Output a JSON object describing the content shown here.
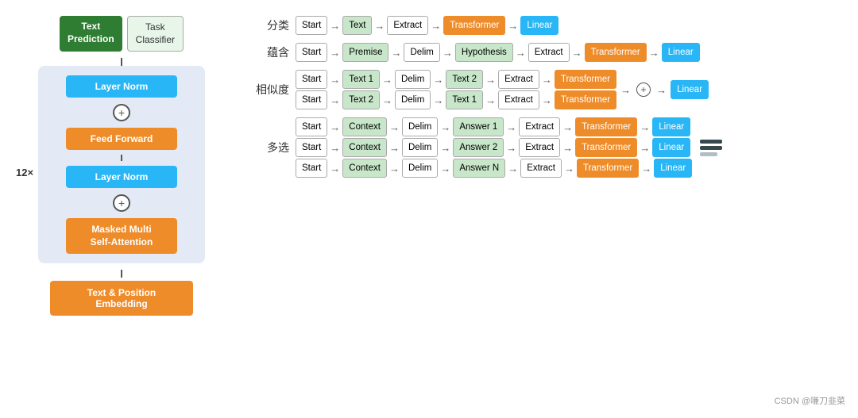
{
  "left": {
    "text_prediction": "Text\nPrediction",
    "task_classifier": "Task\nClassifier",
    "layer_norm_top": "Layer Norm",
    "feed_forward": "Feed Forward",
    "layer_norm_bottom": "Layer Norm",
    "masked_attention": "Masked Multi\nSelf-Attention",
    "embedding": "Text & Position Embedding",
    "label_12x": "12×"
  },
  "tasks": {
    "classification": {
      "label": "分类",
      "sequence": [
        "Start",
        "Text",
        "Extract",
        "Transformer",
        "Linear"
      ]
    },
    "entailment": {
      "label": "蕴含",
      "sequence": [
        "Start",
        "Premise",
        "Delim",
        "Hypothesis",
        "Extract",
        "Transformer",
        "Linear"
      ]
    },
    "similarity": {
      "label": "相似度",
      "row1": [
        "Start",
        "Text 1",
        "Delim",
        "Text 2",
        "Extract",
        "Transformer"
      ],
      "row2": [
        "Start",
        "Text 2",
        "Delim",
        "Text 1",
        "Extract",
        "Transformer"
      ],
      "linear": "Linear"
    },
    "multiple_choice": {
      "label": "多选",
      "row1": [
        "Start",
        "Context",
        "Delim",
        "Answer 1",
        "Extract",
        "Transformer",
        "Linear"
      ],
      "row2": [
        "Start",
        "Context",
        "Delim",
        "Answer 2",
        "Extract",
        "Transformer",
        "Linear"
      ],
      "row3": [
        "Start",
        "Context",
        "Delim",
        "Answer N",
        "Extract",
        "Transformer",
        "Linear"
      ]
    }
  },
  "watermark": "CSDN @嗛刀韭菜"
}
